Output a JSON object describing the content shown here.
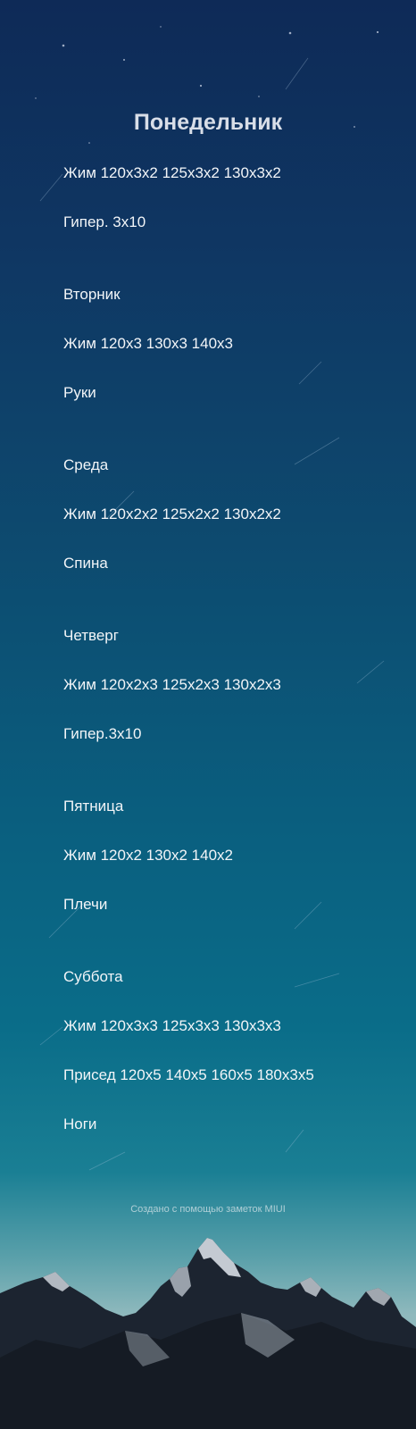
{
  "note": {
    "title": "Понедельник",
    "lines": [
      "Жим 120х3х2 125х3х2 130х3х2",
      "Гипер. 3х10",
      "Вторник",
      "Жим 120х3 130х3 140х3",
      "Руки",
      "Среда",
      "Жим 120х2х2 125х2х2 130х2х2",
      "Спина",
      "Четверг",
      "Жим 120х2х3 125х2х3 130х2х3",
      "Гипер.3х10",
      "Пятница",
      "Жим 120х2 130х2 140х2",
      "Плечи",
      "Суббота",
      "Жим 120х3х3 125х3х3 130х3х3",
      "Присед 120х5 140х5 160х5 180х3х5",
      "Ноги"
    ],
    "footer": "Создано с помощью заметок MIUI"
  },
  "background": {
    "type": "night-sky-mountains",
    "colors": {
      "sky_top": "#0e2a57",
      "sky_mid": "#0a5f7f",
      "horizon": "#8fb9bd",
      "text": "#f2f5f8"
    }
  }
}
